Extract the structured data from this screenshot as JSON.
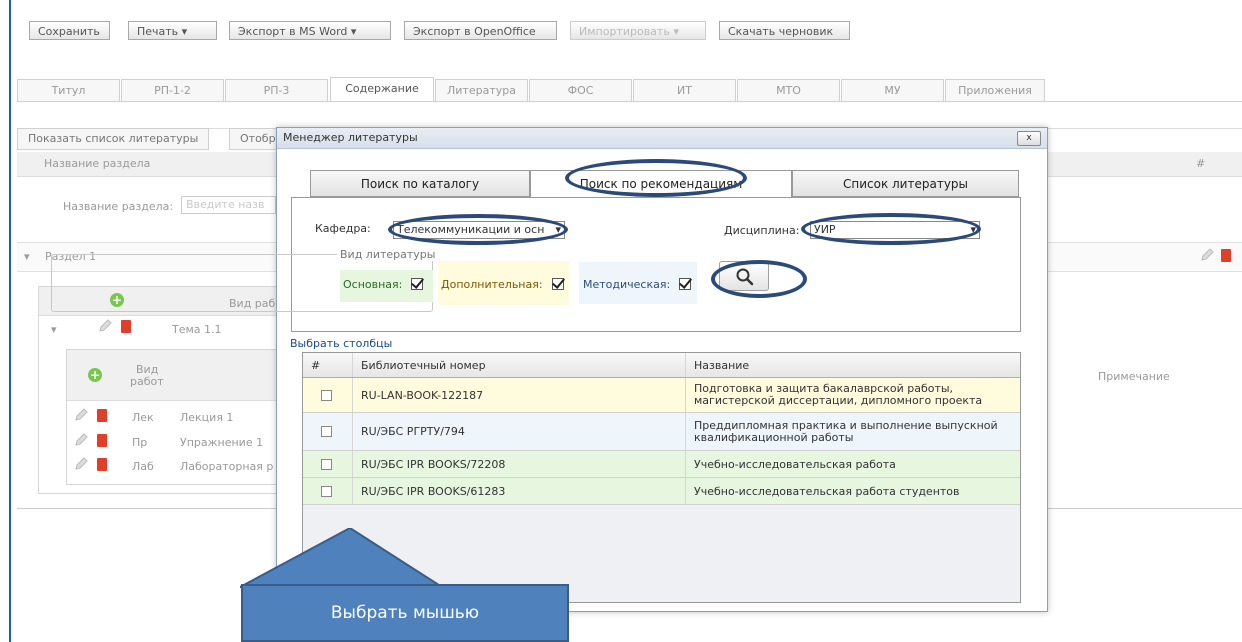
{
  "toolbar": {
    "save": "Сохранить",
    "print": "Печать",
    "export_word": "Экспорт в MS Word",
    "export_openoffice": "Экспорт в OpenOffice",
    "import": "Импортировать",
    "download_draft": "Скачать черновик"
  },
  "tabs": [
    "Титул",
    "РП-1-2",
    "РП-3",
    "Содержание",
    "Литература",
    "ФОС",
    "ИТ",
    "МТО",
    "МУ",
    "Приложения"
  ],
  "background": {
    "show_literature": "Показать список литературы",
    "show_partial": "Отобра",
    "section_name_header": "Название раздела",
    "hash": "#",
    "section_name_label": "Название раздела:",
    "section_name_placeholder": "Введите назв",
    "section1": "Раздел 1",
    "work_type_header": "Вид рабо",
    "topic": "Тема 1.1",
    "vid": "Вид",
    "rabot": "работ",
    "note_header": "Примечание",
    "rows": [
      {
        "abbr": "Лек",
        "name": "Лекция 1"
      },
      {
        "abbr": "Пр",
        "name": "Упражнение 1"
      },
      {
        "abbr": "Лаб",
        "name": "Лабораторная р"
      }
    ]
  },
  "modal": {
    "title": "Менеджер литературы",
    "close": "x",
    "tabs": [
      "Поиск по каталогу",
      "Поиск по рекомендациям",
      "Список литературы"
    ],
    "kafedra_label": "Кафедра:",
    "kafedra_value": "Телекоммуникации и осн",
    "discipline_label": "Дисциплина:",
    "discipline_value": "УИР",
    "lit_type_legend": "Вид литературы",
    "main_label": "Основная:",
    "additional_label": "Дополнительная:",
    "method_label": "Методическая:",
    "choose_columns": "Выбрать столбцы",
    "grid_headers": [
      "#",
      "Библиотечный номер",
      "Название"
    ],
    "grid_rows": [
      {
        "id": "RU-LAN-BOOK-122187",
        "title": "Подготовка и защита бакалаврской работы, магистерской диссертации, дипломного проекта"
      },
      {
        "id": "RU/ЭБС РГРТУ/794",
        "title": "Преддипломная практика и выполнение выпускной квалификационной работы"
      },
      {
        "id": "RU/ЭБС IPR BOOKS/72208",
        "title": "Учебно-исследовательская работа"
      },
      {
        "id": "RU/ЭБС IPR BOOKS/61283",
        "title": "Учебно-исследовательская работа студентов"
      }
    ]
  },
  "callout": "Выбрать мышью",
  "colors": {
    "row_main": "#fffbdc",
    "row_method": "#eef6fb",
    "row_additional": "#e6f6df",
    "callout": "#4f81bd",
    "oval": "#2b4a7a"
  },
  "icons": [
    "search-icon",
    "pencil-icon",
    "trash-icon",
    "add-icon",
    "dropdown-arrow-icon",
    "close-icon"
  ]
}
